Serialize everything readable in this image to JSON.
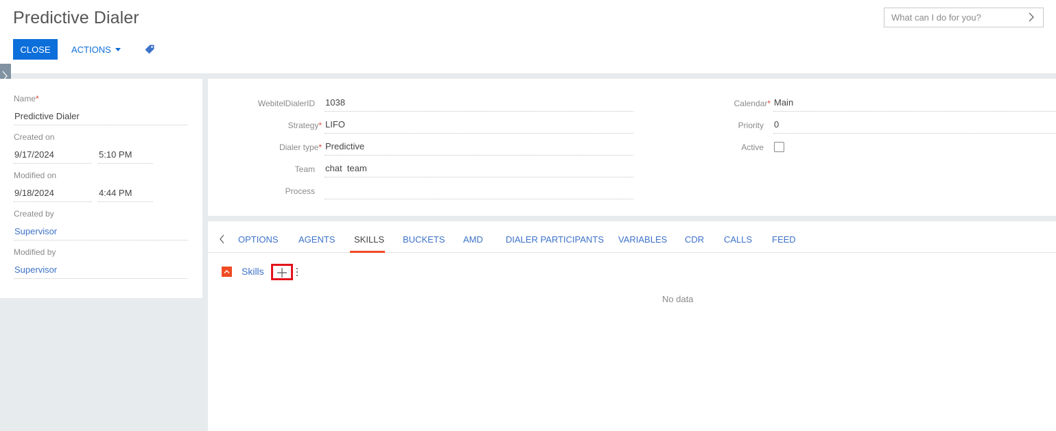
{
  "header": {
    "title": "Predictive Dialer",
    "search_placeholder": "What can I do for you?",
    "close_label": "CLOSE",
    "actions_label": "ACTIONS"
  },
  "left_panel": {
    "name_label": "Name",
    "name_value": "Predictive Dialer",
    "created_on_label": "Created on",
    "created_on_date": "9/17/2024",
    "created_on_time": "5:10 PM",
    "modified_on_label": "Modified on",
    "modified_on_date": "9/18/2024",
    "modified_on_time": "4:44 PM",
    "created_by_label": "Created by",
    "created_by_value": "Supervisor",
    "modified_by_label": "Modified by",
    "modified_by_value": "Supervisor"
  },
  "main": {
    "dialer_id_label": "WebitelDialerID",
    "dialer_id_value": "1038",
    "strategy_label": "Strategy",
    "strategy_value": "LIFO",
    "dialer_type_label": "Dialer type",
    "dialer_type_value": "Predictive",
    "team_label": "Team",
    "team_value": "chat  team",
    "process_label": "Process",
    "process_value": "",
    "calendar_label": "Calendar",
    "calendar_value": "Main",
    "priority_label": "Priority",
    "priority_value": "0",
    "active_label": "Active",
    "active_checked": false
  },
  "tabs": [
    {
      "label": "OPTIONS",
      "active": false
    },
    {
      "label": "AGENTS",
      "active": false
    },
    {
      "label": "SKILLS",
      "active": true
    },
    {
      "label": "BUCKETS",
      "active": false
    },
    {
      "label": "AMD",
      "active": false
    },
    {
      "label": "DIALER PARTICIPANTS",
      "active": false
    },
    {
      "label": "VARIABLES",
      "active": false
    },
    {
      "label": "CDR",
      "active": false
    },
    {
      "label": "CALLS",
      "active": false
    },
    {
      "label": "FEED",
      "active": false
    }
  ],
  "skills_section": {
    "title": "Skills",
    "empty_text": "No data"
  },
  "colors": {
    "primary_blue": "#0d6fda",
    "link_blue": "#3d72c9",
    "accent_orange": "#f04b23",
    "highlight_red": "#e3141b",
    "required_red": "#e0443c"
  }
}
